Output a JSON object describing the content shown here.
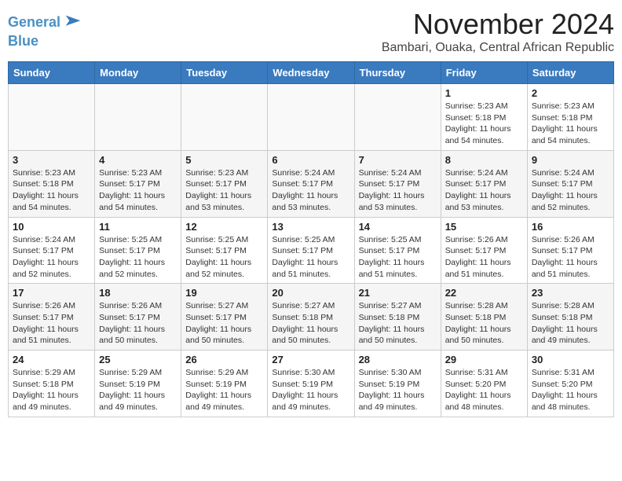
{
  "header": {
    "logo_line1": "General",
    "logo_line2": "Blue",
    "month": "November 2024",
    "location": "Bambari, Ouaka, Central African Republic"
  },
  "weekdays": [
    "Sunday",
    "Monday",
    "Tuesday",
    "Wednesday",
    "Thursday",
    "Friday",
    "Saturday"
  ],
  "weeks": [
    [
      {
        "day": "",
        "info": ""
      },
      {
        "day": "",
        "info": ""
      },
      {
        "day": "",
        "info": ""
      },
      {
        "day": "",
        "info": ""
      },
      {
        "day": "",
        "info": ""
      },
      {
        "day": "1",
        "info": "Sunrise: 5:23 AM\nSunset: 5:18 PM\nDaylight: 11 hours and 54 minutes."
      },
      {
        "day": "2",
        "info": "Sunrise: 5:23 AM\nSunset: 5:18 PM\nDaylight: 11 hours and 54 minutes."
      }
    ],
    [
      {
        "day": "3",
        "info": "Sunrise: 5:23 AM\nSunset: 5:18 PM\nDaylight: 11 hours and 54 minutes."
      },
      {
        "day": "4",
        "info": "Sunrise: 5:23 AM\nSunset: 5:17 PM\nDaylight: 11 hours and 54 minutes."
      },
      {
        "day": "5",
        "info": "Sunrise: 5:23 AM\nSunset: 5:17 PM\nDaylight: 11 hours and 53 minutes."
      },
      {
        "day": "6",
        "info": "Sunrise: 5:24 AM\nSunset: 5:17 PM\nDaylight: 11 hours and 53 minutes."
      },
      {
        "day": "7",
        "info": "Sunrise: 5:24 AM\nSunset: 5:17 PM\nDaylight: 11 hours and 53 minutes."
      },
      {
        "day": "8",
        "info": "Sunrise: 5:24 AM\nSunset: 5:17 PM\nDaylight: 11 hours and 53 minutes."
      },
      {
        "day": "9",
        "info": "Sunrise: 5:24 AM\nSunset: 5:17 PM\nDaylight: 11 hours and 52 minutes."
      }
    ],
    [
      {
        "day": "10",
        "info": "Sunrise: 5:24 AM\nSunset: 5:17 PM\nDaylight: 11 hours and 52 minutes."
      },
      {
        "day": "11",
        "info": "Sunrise: 5:25 AM\nSunset: 5:17 PM\nDaylight: 11 hours and 52 minutes."
      },
      {
        "day": "12",
        "info": "Sunrise: 5:25 AM\nSunset: 5:17 PM\nDaylight: 11 hours and 52 minutes."
      },
      {
        "day": "13",
        "info": "Sunrise: 5:25 AM\nSunset: 5:17 PM\nDaylight: 11 hours and 51 minutes."
      },
      {
        "day": "14",
        "info": "Sunrise: 5:25 AM\nSunset: 5:17 PM\nDaylight: 11 hours and 51 minutes."
      },
      {
        "day": "15",
        "info": "Sunrise: 5:26 AM\nSunset: 5:17 PM\nDaylight: 11 hours and 51 minutes."
      },
      {
        "day": "16",
        "info": "Sunrise: 5:26 AM\nSunset: 5:17 PM\nDaylight: 11 hours and 51 minutes."
      }
    ],
    [
      {
        "day": "17",
        "info": "Sunrise: 5:26 AM\nSunset: 5:17 PM\nDaylight: 11 hours and 51 minutes."
      },
      {
        "day": "18",
        "info": "Sunrise: 5:26 AM\nSunset: 5:17 PM\nDaylight: 11 hours and 50 minutes."
      },
      {
        "day": "19",
        "info": "Sunrise: 5:27 AM\nSunset: 5:17 PM\nDaylight: 11 hours and 50 minutes."
      },
      {
        "day": "20",
        "info": "Sunrise: 5:27 AM\nSunset: 5:18 PM\nDaylight: 11 hours and 50 minutes."
      },
      {
        "day": "21",
        "info": "Sunrise: 5:27 AM\nSunset: 5:18 PM\nDaylight: 11 hours and 50 minutes."
      },
      {
        "day": "22",
        "info": "Sunrise: 5:28 AM\nSunset: 5:18 PM\nDaylight: 11 hours and 50 minutes."
      },
      {
        "day": "23",
        "info": "Sunrise: 5:28 AM\nSunset: 5:18 PM\nDaylight: 11 hours and 49 minutes."
      }
    ],
    [
      {
        "day": "24",
        "info": "Sunrise: 5:29 AM\nSunset: 5:18 PM\nDaylight: 11 hours and 49 minutes."
      },
      {
        "day": "25",
        "info": "Sunrise: 5:29 AM\nSunset: 5:19 PM\nDaylight: 11 hours and 49 minutes."
      },
      {
        "day": "26",
        "info": "Sunrise: 5:29 AM\nSunset: 5:19 PM\nDaylight: 11 hours and 49 minutes."
      },
      {
        "day": "27",
        "info": "Sunrise: 5:30 AM\nSunset: 5:19 PM\nDaylight: 11 hours and 49 minutes."
      },
      {
        "day": "28",
        "info": "Sunrise: 5:30 AM\nSunset: 5:19 PM\nDaylight: 11 hours and 49 minutes."
      },
      {
        "day": "29",
        "info": "Sunrise: 5:31 AM\nSunset: 5:20 PM\nDaylight: 11 hours and 48 minutes."
      },
      {
        "day": "30",
        "info": "Sunrise: 5:31 AM\nSunset: 5:20 PM\nDaylight: 11 hours and 48 minutes."
      }
    ]
  ]
}
